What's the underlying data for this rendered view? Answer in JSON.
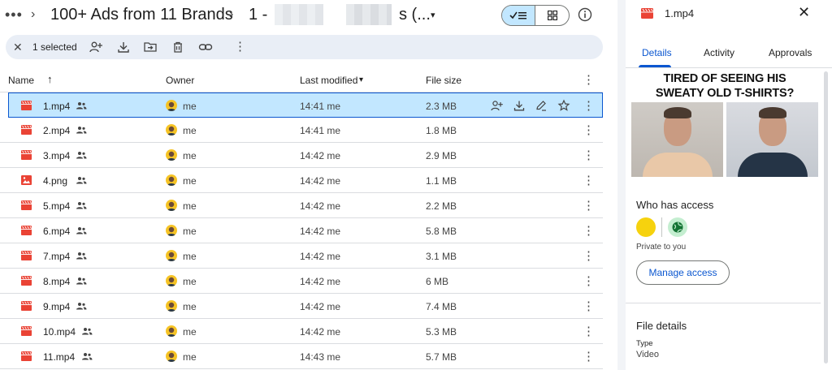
{
  "breadcrumb": {
    "more": "•••",
    "sep": "›",
    "folder": "100+ Ads from 11 Brands",
    "current_prefix": "1 -",
    "current_suffix": "s (...",
    "caret": "▾"
  },
  "view_toggle": {
    "list_icon": "check-list-icon",
    "grid_icon": "grid-icon"
  },
  "selection_bar": {
    "close": "✕",
    "count": "1 selected",
    "actions": [
      "add-person-icon",
      "download-icon",
      "move-to-folder-icon",
      "trash-icon",
      "link-icon",
      "more-vert-icon"
    ],
    "more": "⋮"
  },
  "table": {
    "headers": {
      "name": "Name",
      "sort_arrow": "↑",
      "owner": "Owner",
      "modified": "Last modified",
      "modified_caret": "▾",
      "size": "File size",
      "more": "⋮"
    },
    "rows": [
      {
        "name": "1.mp4",
        "type": "video",
        "owner": "me",
        "modified": "14:41 me",
        "size": "2.3 MB",
        "selected": true
      },
      {
        "name": "2.mp4",
        "type": "video",
        "owner": "me",
        "modified": "14:41 me",
        "size": "1.8 MB"
      },
      {
        "name": "3.mp4",
        "type": "video",
        "owner": "me",
        "modified": "14:42 me",
        "size": "2.9 MB"
      },
      {
        "name": "4.png",
        "type": "image",
        "owner": "me",
        "modified": "14:42 me",
        "size": "1.1 MB"
      },
      {
        "name": "5.mp4",
        "type": "video",
        "owner": "me",
        "modified": "14:42 me",
        "size": "2.2 MB"
      },
      {
        "name": "6.mp4",
        "type": "video",
        "owner": "me",
        "modified": "14:42 me",
        "size": "5.8 MB"
      },
      {
        "name": "7.mp4",
        "type": "video",
        "owner": "me",
        "modified": "14:42 me",
        "size": "3.1 MB"
      },
      {
        "name": "8.mp4",
        "type": "video",
        "owner": "me",
        "modified": "14:42 me",
        "size": "6 MB"
      },
      {
        "name": "9.mp4",
        "type": "video",
        "owner": "me",
        "modified": "14:42 me",
        "size": "7.4 MB"
      },
      {
        "name": "10.mp4",
        "type": "video",
        "owner": "me",
        "modified": "14:42 me",
        "size": "5.3 MB"
      },
      {
        "name": "11.mp4",
        "type": "video",
        "owner": "me",
        "modified": "14:43 me",
        "size": "5.7 MB"
      }
    ],
    "row_more": "⋮"
  },
  "panel": {
    "title": "1.mp4",
    "close": "✕",
    "tabs": [
      "Details",
      "Activity",
      "Approvals"
    ],
    "thumbnail_caption_1": "TIRED OF SEEING HIS",
    "thumbnail_caption_2": "SWEATY OLD T-SHIRTS?",
    "who_has_access": "Who has access",
    "private": "Private to you",
    "manage_access": "Manage access",
    "file_details": "File details",
    "type_label": "Type",
    "type_value": "Video"
  },
  "colors": {
    "accent": "#0b57d0",
    "selected_row": "#c2e7ff",
    "file_icon_red": "#ea4335"
  }
}
